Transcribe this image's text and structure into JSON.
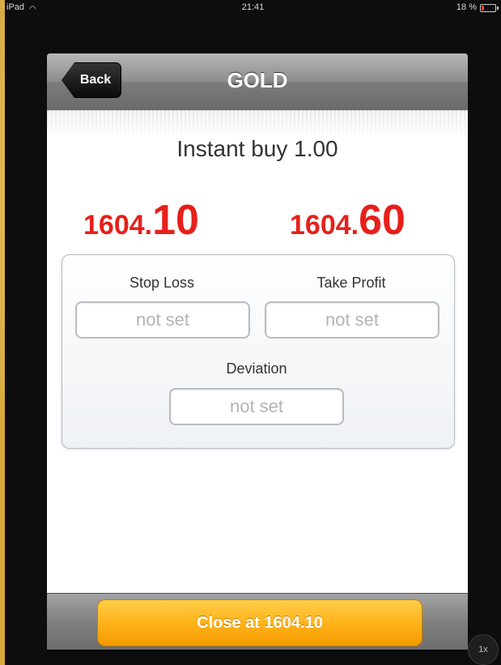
{
  "status_bar": {
    "device": "iPad",
    "time": "21:41",
    "battery": "18 %"
  },
  "nav": {
    "back_label": "Back",
    "title": "GOLD"
  },
  "order": {
    "title": "Instant buy 1.00",
    "bid_small": "1604.",
    "bid_large": "10",
    "ask_small": "1604.",
    "ask_large": "60"
  },
  "settings": {
    "stop_loss_label": "Stop Loss",
    "stop_loss_value": "not set",
    "take_profit_label": "Take Profit",
    "take_profit_value": "not set",
    "deviation_label": "Deviation",
    "deviation_value": "not set"
  },
  "action": {
    "close_label": "Close at 1604.10"
  },
  "zoom": {
    "label": "1x"
  },
  "colors": {
    "price_red": "#e6201b",
    "button_orange": "#ffb31a",
    "background_gold": "#d8a93c"
  }
}
